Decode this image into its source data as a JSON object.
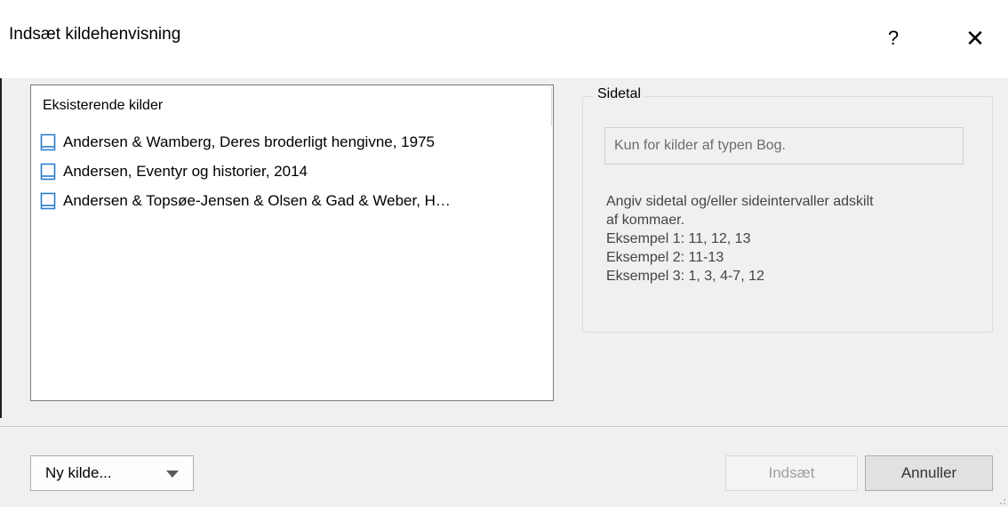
{
  "dialog": {
    "title": "Indsæt kildehenvisning",
    "help_glyph": "?",
    "close_glyph": "✕"
  },
  "sources": {
    "header": "Eksisterende kilder",
    "items": [
      {
        "label": "Andersen & Wamberg, Deres broderligt hengivne, 1975",
        "icon": "book-icon"
      },
      {
        "label": "Andersen, Eventyr og historier, 2014",
        "icon": "book-icon"
      },
      {
        "label": "Andersen & Topsøe-Jensen & Olsen & Gad & Weber, H…",
        "icon": "book-icon"
      }
    ]
  },
  "page_group": {
    "title": "Sidetal",
    "input_placeholder": "Kun for kilder af typen Bog.",
    "hints": [
      "Angiv sidetal og/eller sideintervaller adskilt",
      "af kommaer.",
      "Eksempel 1: 11, 12, 13",
      "Eksempel 2: 11-13",
      "Eksempel 3: 1, 3, 4-7, 12"
    ]
  },
  "buttons": {
    "new_source": "Ny kilde...",
    "insert": "Indsæt",
    "cancel": "Annuller"
  },
  "colors": {
    "book_icon": "#2a7dd1",
    "disabled_text": "#a0a0a0"
  }
}
